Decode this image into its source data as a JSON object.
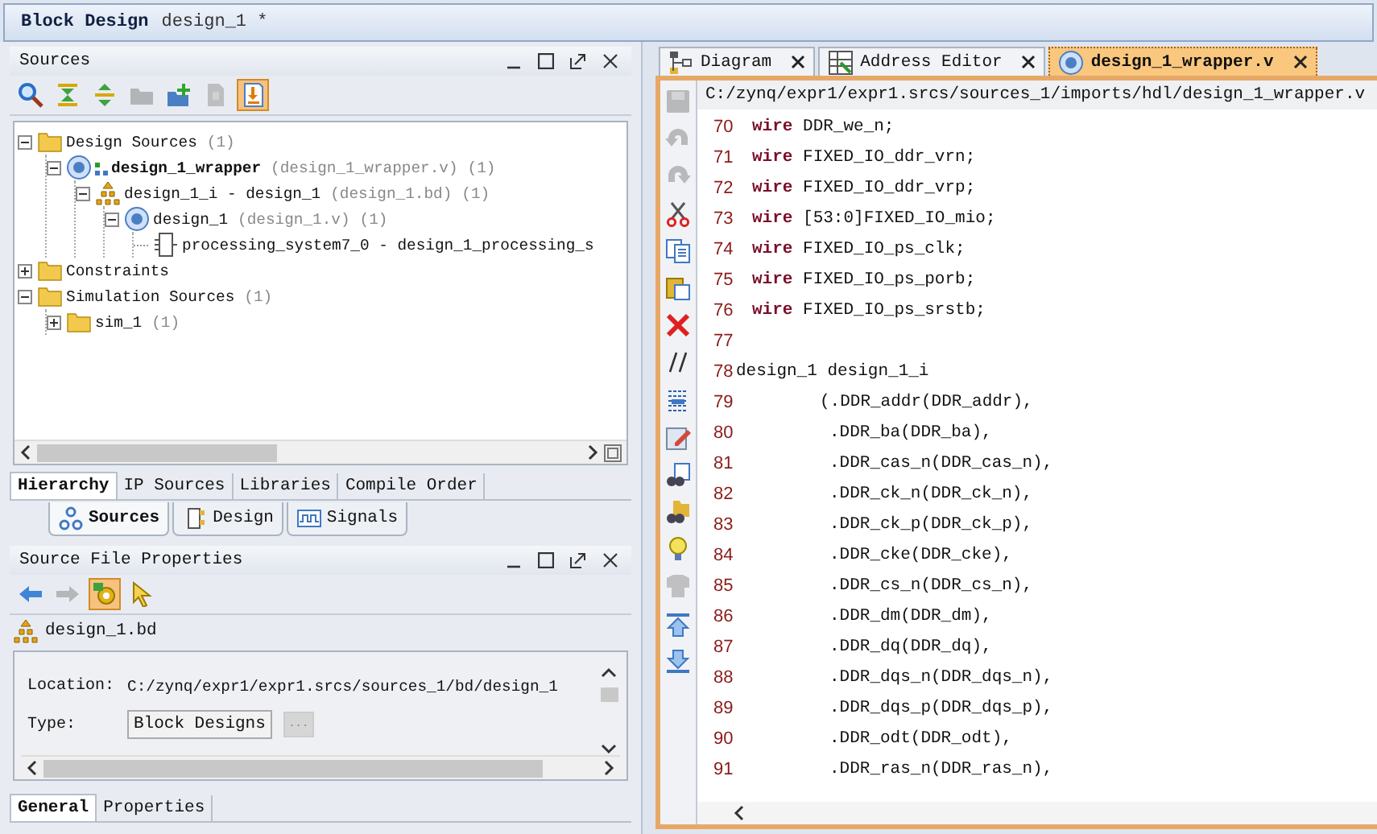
{
  "window": {
    "title": "Block Design",
    "subtitle": "design_1 *"
  },
  "sources_panel": {
    "title": "Sources",
    "toolbar": [
      {
        "kind": "search",
        "selected": false,
        "disabled": false
      },
      {
        "kind": "collapse",
        "selected": false,
        "disabled": false
      },
      {
        "kind": "expand",
        "selected": false,
        "disabled": false
      },
      {
        "kind": "folder",
        "selected": false,
        "disabled": true
      },
      {
        "kind": "add",
        "selected": false,
        "disabled": false
      },
      {
        "kind": "document",
        "selected": false,
        "disabled": true
      },
      {
        "kind": "import",
        "selected": true,
        "disabled": false
      }
    ],
    "tree": [
      {
        "kind": "folder",
        "label": "Design Sources",
        "count": "(1)",
        "expanded": true,
        "top": false,
        "children": [
          {
            "kind": "verilog",
            "label": "design_1_wrapper",
            "detail": "(design_1_wrapper.v)",
            "count": "(1)",
            "expanded": true,
            "top": true,
            "children": [
              {
                "kind": "block",
                "label": "design_1_i - design_1",
                "detail": "(design_1.bd)",
                "count": "(1)",
                "expanded": true,
                "top": false,
                "children": [
                  {
                    "kind": "verilog-plain",
                    "label": "design_1",
                    "detail": "(design_1.v)",
                    "count": "(1)",
                    "expanded": true,
                    "top": false,
                    "children": [
                      {
                        "kind": "ip",
                        "label": "processing_system7_0 - design_1_processing_s",
                        "top": false
                      }
                    ]
                  }
                ]
              }
            ]
          }
        ]
      },
      {
        "kind": "folder",
        "label": "Constraints",
        "expanded": false,
        "top": false
      },
      {
        "kind": "folder",
        "label": "Simulation Sources",
        "count": "(1)",
        "expanded": true,
        "top": false,
        "children": [
          {
            "kind": "folder",
            "label": "sim_1",
            "count": "(1)",
            "expanded": false,
            "top": false
          }
        ]
      }
    ],
    "tabs": [
      {
        "label": "Hierarchy",
        "selected": true
      },
      {
        "label": "IP Sources",
        "selected": false
      },
      {
        "label": "Libraries",
        "selected": false
      },
      {
        "label": "Compile Order",
        "selected": false
      }
    ]
  },
  "view_tabs": [
    {
      "kind": "sources",
      "label": "Sources",
      "selected": true
    },
    {
      "kind": "design",
      "label": "Design",
      "selected": false
    },
    {
      "kind": "signals",
      "label": "Signals",
      "selected": false
    }
  ],
  "properties_panel": {
    "title": "Source File Properties",
    "toolbar": [
      {
        "kind": "back",
        "selected": false,
        "disabled": false
      },
      {
        "kind": "forward",
        "selected": false,
        "disabled": true
      },
      {
        "kind": "settings",
        "selected": true,
        "disabled": false
      },
      {
        "kind": "pointer",
        "selected": false,
        "disabled": false
      }
    ],
    "file": "design_1.bd",
    "fields": [
      {
        "kind": "text",
        "label": "Location:",
        "value": "C:/zynq/expr1/expr1.srcs/sources_1/bd/design_1"
      },
      {
        "kind": "button",
        "label": "Type:",
        "value": "Block Designs",
        "extra": "..."
      }
    ],
    "tabs": [
      {
        "label": "General",
        "selected": true
      },
      {
        "label": "Properties",
        "selected": false
      }
    ]
  },
  "editor": {
    "tabs": [
      {
        "kind": "diagram",
        "label": "Diagram",
        "selected": false
      },
      {
        "kind": "address",
        "label": "Address Editor",
        "selected": false
      },
      {
        "kind": "verilog",
        "label": "design_1_wrapper.v",
        "selected": true
      }
    ],
    "path": "C:/zynq/expr1/expr1.srcs/sources_1/imports/hdl/design_1_wrapper.v",
    "toolbar": [
      {
        "kind": "save",
        "disabled": true
      },
      {
        "kind": "undo",
        "disabled": true
      },
      {
        "kind": "redo",
        "disabled": true
      },
      {
        "kind": "cut",
        "disabled": false
      },
      {
        "kind": "copy",
        "disabled": false
      },
      {
        "kind": "paste",
        "disabled": false
      },
      {
        "kind": "delete",
        "disabled": false
      },
      {
        "kind": "comment",
        "disabled": false
      },
      {
        "kind": "lines",
        "disabled": false
      },
      {
        "kind": "edit",
        "disabled": false
      },
      {
        "kind": "find",
        "disabled": false
      },
      {
        "kind": "find-files",
        "disabled": false
      },
      {
        "kind": "bulb",
        "disabled": false
      },
      {
        "kind": "shirt",
        "disabled": true
      },
      {
        "kind": "top",
        "disabled": false
      },
      {
        "kind": "bottom",
        "disabled": false
      }
    ],
    "lines": [
      {
        "number": "70",
        "kind": "declaration",
        "code": "**wire** DDR_we_n;"
      },
      {
        "number": "71",
        "kind": "declaration",
        "code": "**wire** FIXED_IO_ddr_vrn;"
      },
      {
        "number": "72",
        "kind": "declaration",
        "code": "**wire** FIXED_IO_ddr_vrp;"
      },
      {
        "number": "73",
        "kind": "declaration",
        "code": "**wire** [53:0]FIXED_IO_mio;"
      },
      {
        "number": "74",
        "kind": "declaration",
        "code": "**wire** FIXED_IO_ps_clk;"
      },
      {
        "number": "75",
        "kind": "declaration",
        "code": "**wire** FIXED_IO_ps_porb;"
      },
      {
        "number": "76",
        "kind": "declaration",
        "code": "**wire** FIXED_IO_ps_srstb;"
      },
      {
        "number": "77",
        "kind": "blank"
      },
      {
        "number": "78",
        "kind": "instance",
        "code": "design_1 design_1_i"
      },
      {
        "number": "79",
        "kind": "open",
        "code": "(.DDR_addr(DDR_addr),"
      },
      {
        "number": "80",
        "kind": "port",
        "code": ".DDR_ba(DDR_ba),"
      },
      {
        "number": "81",
        "kind": "port",
        "code": ".DDR_cas_n(DDR_cas_n),"
      },
      {
        "number": "82",
        "kind": "port",
        "code": ".DDR_ck_n(DDR_ck_n),"
      },
      {
        "number": "83",
        "kind": "port",
        "code": ".DDR_ck_p(DDR_ck_p),"
      },
      {
        "number": "84",
        "kind": "port",
        "code": ".DDR_cke(DDR_cke),"
      },
      {
        "number": "85",
        "kind": "port",
        "code": ".DDR_cs_n(DDR_cs_n),"
      },
      {
        "number": "86",
        "kind": "port",
        "code": ".DDR_dm(DDR_dm),"
      },
      {
        "number": "87",
        "kind": "port",
        "code": ".DDR_dq(DDR_dq),"
      },
      {
        "number": "88",
        "kind": "port",
        "code": ".DDR_dqs_n(DDR_dqs_n),"
      },
      {
        "number": "89",
        "kind": "port",
        "code": ".DDR_dqs_p(DDR_dqs_p),"
      },
      {
        "number": "90",
        "kind": "port",
        "code": ".DDR_odt(DDR_odt),"
      },
      {
        "number": "91",
        "kind": "port",
        "code": ".DDR_ras_n(DDR_ras_n),"
      }
    ]
  }
}
